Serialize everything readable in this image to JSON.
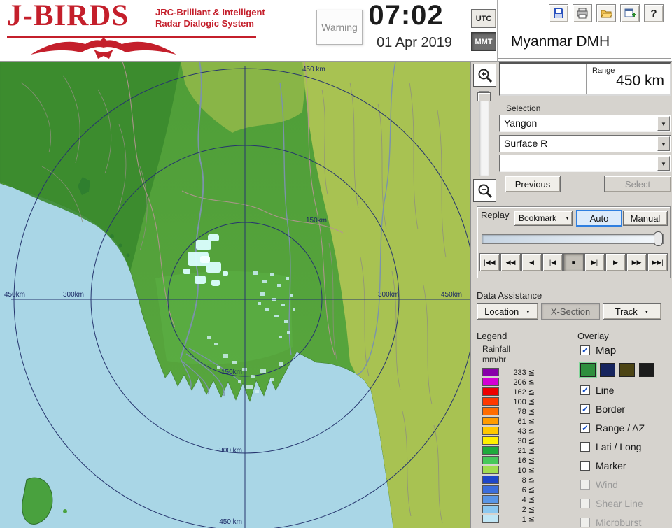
{
  "header": {
    "logo_title": "J-BIRDS",
    "logo_sub1": "JRC-Brilliant & Intelligent",
    "logo_sub2": "Radar  Dialogic  System",
    "warning": "Warning",
    "time": "07:02",
    "date": "01 Apr 2019",
    "tz_utc": "UTC",
    "tz_mmt": "MMT",
    "tz_selected": "MMT",
    "station": "Myanmar DMH",
    "toolbar": {
      "icons": [
        "save",
        "print",
        "open-folder",
        "new-window",
        "help"
      ],
      "help_glyph": "?"
    }
  },
  "range": {
    "label": "Range",
    "value": "450 km"
  },
  "selection": {
    "label": "Selection",
    "site": "Yangon",
    "product": "Surface R",
    "extra": "",
    "previous": "Previous",
    "select": "Select"
  },
  "replay": {
    "label": "Replay",
    "bookmark": "Bookmark",
    "auto": "Auto",
    "manual": "Manual",
    "mode_selected": "Auto",
    "playback": [
      "|◀◀",
      "◀◀",
      "◀",
      "|◀",
      "■",
      "▶|",
      "▶",
      "▶▶",
      "▶▶|"
    ]
  },
  "data_assistance": {
    "label": "Data Assistance",
    "location": "Location",
    "xsection": "X-Section",
    "track": "Track"
  },
  "legend": {
    "label": "Legend",
    "unit_line1": "Rainfall",
    "unit_line2": "mm/hr",
    "rows": [
      {
        "color": "#8800aa",
        "value": "233 ≦"
      },
      {
        "color": "#d400d4",
        "value": "206 ≦"
      },
      {
        "color": "#ee0000",
        "value": "162 ≦"
      },
      {
        "color": "#ff3800",
        "value": "100 ≦"
      },
      {
        "color": "#ff6c00",
        "value": "78 ≦"
      },
      {
        "color": "#ff9c00",
        "value": "61 ≦"
      },
      {
        "color": "#ffc800",
        "value": "43 ≦"
      },
      {
        "color": "#fff000",
        "value": "30 ≦"
      },
      {
        "color": "#1eaa3c",
        "value": "21 ≦"
      },
      {
        "color": "#46c85a",
        "value": "16 ≦"
      },
      {
        "color": "#a0dc50",
        "value": "10 ≦"
      },
      {
        "color": "#1e46c8",
        "value": "8 ≦"
      },
      {
        "color": "#3c6edc",
        "value": "6 ≦"
      },
      {
        "color": "#5a96e6",
        "value": "4 ≦"
      },
      {
        "color": "#8cc8f0",
        "value": "2 ≦"
      },
      {
        "color": "#c0e6f5",
        "value": "1 ≦"
      }
    ]
  },
  "overlay": {
    "label": "Overlay",
    "items": [
      {
        "label": "Map",
        "checked": true,
        "enabled": true
      },
      {
        "label": "Line",
        "checked": true,
        "enabled": true
      },
      {
        "label": "Border",
        "checked": true,
        "enabled": true
      },
      {
        "label": "Range / AZ",
        "checked": true,
        "enabled": true
      },
      {
        "label": "Lati / Long",
        "checked": false,
        "enabled": true
      },
      {
        "label": "Marker",
        "checked": false,
        "enabled": true
      },
      {
        "label": "Wind",
        "checked": false,
        "enabled": false
      },
      {
        "label": "Shear Line",
        "checked": false,
        "enabled": false
      },
      {
        "label": "Microburst",
        "checked": false,
        "enabled": false
      }
    ],
    "map_colors": [
      "#2e8f3e",
      "#16245e",
      "#4c4414",
      "#1c1c1c"
    ]
  },
  "map": {
    "ring_labels": [
      "450 km",
      "150km",
      "450km",
      "300km",
      "300km",
      "450km",
      "150km",
      "300 km",
      "450 km"
    ]
  }
}
